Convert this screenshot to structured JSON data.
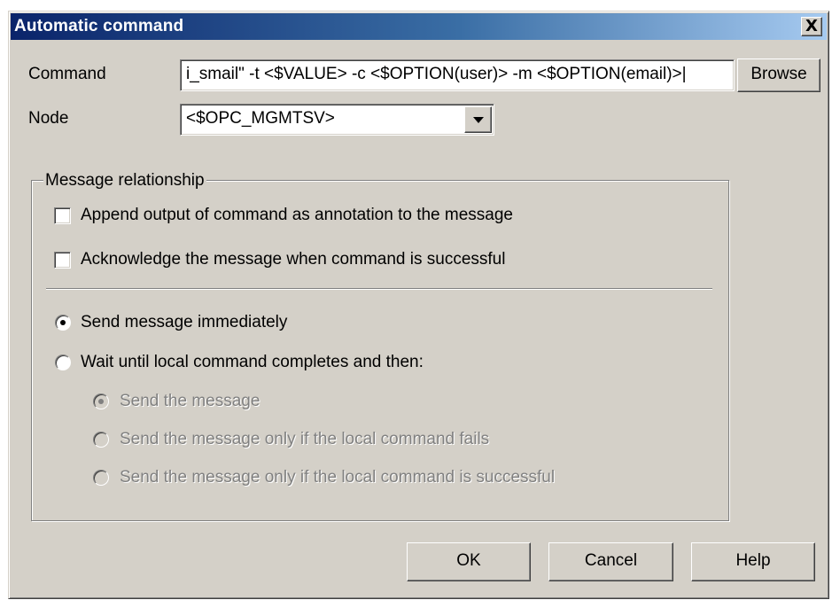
{
  "window": {
    "title": "Automatic command",
    "close_glyph": "X"
  },
  "command": {
    "label": "Command",
    "value": "i_smail\" -t <$VALUE> -c <$OPTION(user)> -m <$OPTION(email)>|",
    "browse_label": "Browse"
  },
  "node": {
    "label": "Node",
    "selected": "<$OPC_MGMTSV>"
  },
  "message_relationship": {
    "legend": "Message relationship",
    "checkboxes": [
      {
        "label": "Append output of command as annotation to the message",
        "checked": false
      },
      {
        "label": "Acknowledge the message when command is successful",
        "checked": false
      }
    ],
    "radios": [
      {
        "label": "Send message immediately",
        "selected": true
      },
      {
        "label": "Wait until local command completes and then:",
        "selected": false
      }
    ],
    "sub_radios": [
      {
        "label": "Send the message",
        "selected": true,
        "enabled": false
      },
      {
        "label": "Send the message only if the local command fails",
        "selected": false,
        "enabled": false
      },
      {
        "label": "Send the message only if the local command is successful",
        "selected": false,
        "enabled": false
      }
    ]
  },
  "buttons": {
    "ok": "OK",
    "cancel": "Cancel",
    "help": "Help"
  }
}
